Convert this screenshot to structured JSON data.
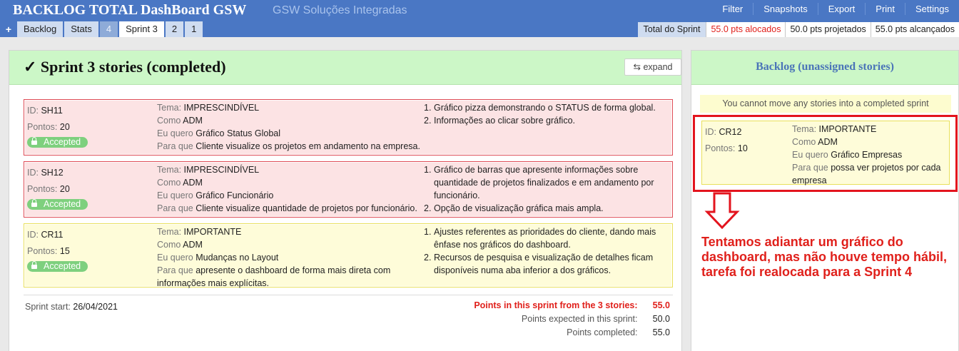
{
  "header": {
    "title": "BACKLOG TOTAL DashBoard GSW",
    "subtitle": "GSW Soluções Integradas",
    "menu": [
      "Filter",
      "Snapshots",
      "Export",
      "Print",
      "Settings"
    ],
    "plus": "+",
    "tabs": [
      "Backlog",
      "Stats",
      "4",
      "Sprint 3",
      "2",
      "1"
    ]
  },
  "sprint_stats": {
    "label": "Total do Sprint",
    "allocated": "55.0 pts alocados",
    "projected": "50.0 pts projetados",
    "achieved": "55.0 pts alcançados"
  },
  "main": {
    "title": "✓ Sprint 3 stories (completed)",
    "expand": "⇆ expand",
    "stories": [
      {
        "id_label": "ID:",
        "id": "SH11",
        "points_label": "Pontos:",
        "points": "20",
        "status": "Accepted",
        "tema_label": "Tema:",
        "tema": "IMPRESCINDÍVEL",
        "como_label": "Como",
        "como": "ADM",
        "quero_label": "Eu quero",
        "quero": "Gráfico Status Global",
        "para_label": "Para que",
        "para": "Cliente visualize os projetos em andamento na empresa.",
        "criteria": [
          "Gráfico pizza demonstrando o STATUS de forma global.",
          "Informações ao clicar sobre gráfico."
        ]
      },
      {
        "id_label": "ID:",
        "id": "SH12",
        "points_label": "Pontos:",
        "points": "20",
        "status": "Accepted",
        "tema_label": "Tema:",
        "tema": "IMPRESCINDÍVEL",
        "como_label": "Como",
        "como": "ADM",
        "quero_label": "Eu quero",
        "quero": "Gráfico Funcionário",
        "para_label": "Para que",
        "para": "Cliente visualize quantidade de projetos por funcionário.",
        "criteria": [
          "Gráfico de barras que apresente informações sobre quantidade de projetos finalizados e em andamento por funcionário.",
          "Opção de visualização gráfica mais ampla."
        ]
      },
      {
        "id_label": "ID:",
        "id": "CR11",
        "points_label": "Pontos:",
        "points": "15",
        "status": "Accepted",
        "tema_label": "Tema:",
        "tema": "IMPORTANTE",
        "como_label": "Como",
        "como": "ADM",
        "quero_label": "Eu quero",
        "quero": "Mudanças no Layout",
        "para_label": "Para que",
        "para": "apresente o dashboard de forma mais direta com informações mais explícitas.",
        "criteria": [
          "Ajustes referentes as prioridades do cliente, dando mais ênfase nos gráficos do dashboard.",
          "Recursos de pesquisa e visualização de detalhes ficam disponíveis numa aba inferior a dos gráficos."
        ]
      }
    ],
    "sprint_start_label": "Sprint start:",
    "sprint_start": "26/04/2021",
    "points_in_sprint_label": "Points in this sprint from the 3 stories:",
    "points_in_sprint": "55.0",
    "points_expected_label": "Points expected in this sprint:",
    "points_expected": "50.0",
    "points_completed_label": "Points completed:",
    "points_completed": "55.0"
  },
  "backlog": {
    "title": "Backlog (unassigned stories)",
    "notice": "You cannot move any stories into a completed sprint",
    "story": {
      "id_label": "ID:",
      "id": "CR12",
      "points_label": "Pontos:",
      "points": "10",
      "tema_label": "Tema:",
      "tema": "IMPORTANTE",
      "como_label": "Como",
      "como": "ADM",
      "quero_label": "Eu quero",
      "quero": "Gráfico Empresas",
      "para_label": "Para que",
      "para": "possa ver projetos por cada empresa"
    },
    "annotation": "Tentamos adiantar um gráfico do dashboard, mas não houve tempo hábil, tarefa foi realocada para a Sprint 4",
    "annotation_color": "#e0201b"
  }
}
